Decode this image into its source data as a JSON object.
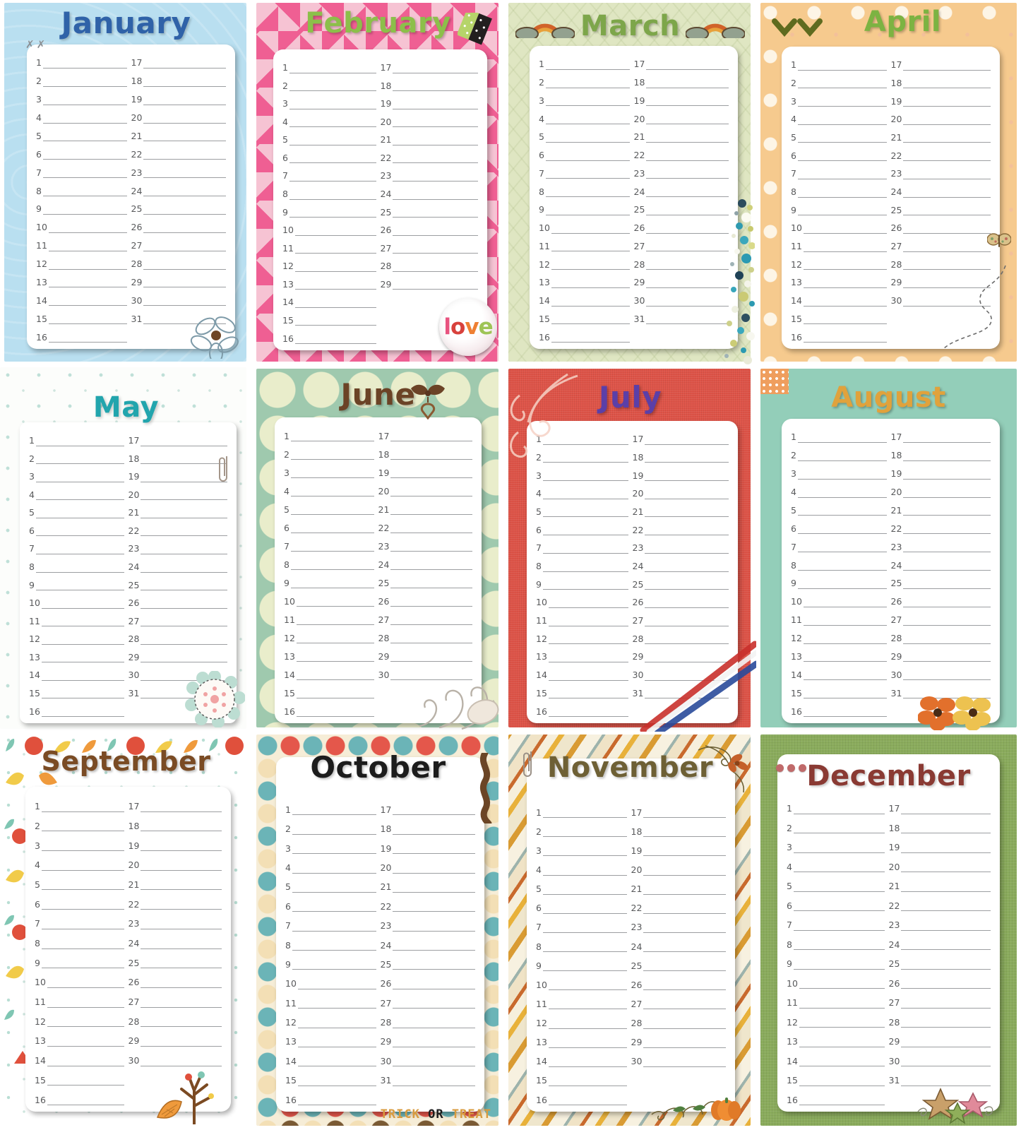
{
  "page": {
    "kind": "printable-monthly-planner-sheet",
    "layout": "3 rows x 4 columns of month cards",
    "left_column_days": [
      1,
      2,
      3,
      4,
      5,
      6,
      7,
      8,
      9,
      10,
      11,
      12,
      13,
      14,
      15,
      16
    ],
    "title_color_note": "each month title uses its own decorative color"
  },
  "months": [
    {
      "id": "january",
      "title": "January",
      "title_color": "#2f62a8",
      "theme_color": "#b9dff0",
      "left_days": [
        "1",
        "2",
        "3",
        "4",
        "5",
        "6",
        "7",
        "8",
        "9",
        "10",
        "11",
        "12",
        "13",
        "14",
        "15",
        "16"
      ],
      "right_days": [
        "17",
        "18",
        "19",
        "20",
        "21",
        "22",
        "23",
        "24",
        "25",
        "26",
        "27",
        "28",
        "29",
        "30",
        "31",
        ""
      ],
      "day_count": 31,
      "decorations": [
        "stitch-marks",
        "wire-flower-brad"
      ]
    },
    {
      "id": "february",
      "title": "February",
      "title_color": "#8cbf4a",
      "theme_color": "#ef5f93",
      "left_days": [
        "1",
        "2",
        "3",
        "4",
        "5",
        "6",
        "7",
        "8",
        "9",
        "10",
        "11",
        "12",
        "13",
        "14",
        "15",
        "16"
      ],
      "right_days": [
        "17",
        "18",
        "19",
        "20",
        "21",
        "22",
        "23",
        "24",
        "25",
        "26",
        "27",
        "28",
        "29",
        "",
        "",
        ""
      ],
      "day_count": 29,
      "decorations": [
        "washi-tape",
        "love-badge"
      ],
      "badge_text": "love",
      "badge_letters": [
        {
          "ch": "l",
          "color": "#e8537f"
        },
        {
          "ch": "o",
          "color": "#d8413c"
        },
        {
          "ch": "v",
          "color": "#ef8033"
        },
        {
          "ch": "e",
          "color": "#9ec456"
        }
      ]
    },
    {
      "id": "march",
      "title": "March",
      "title_color": "#7da64a",
      "theme_color": "#dfe6c2",
      "left_days": [
        "1",
        "2",
        "3",
        "4",
        "5",
        "6",
        "7",
        "8",
        "9",
        "10",
        "11",
        "12",
        "13",
        "14",
        "15",
        "16"
      ],
      "right_days": [
        "17",
        "18",
        "19",
        "20",
        "21",
        "22",
        "23",
        "24",
        "25",
        "26",
        "27",
        "28",
        "29",
        "30",
        "31",
        ""
      ],
      "day_count": 31,
      "decorations": [
        "rainbow-cloud-left",
        "rainbow-cloud-right",
        "bead-cluster"
      ]
    },
    {
      "id": "april",
      "title": "April",
      "title_color": "#7cb342",
      "theme_color": "#f6ca8e",
      "left_days": [
        "1",
        "2",
        "3",
        "4",
        "5",
        "6",
        "7",
        "8",
        "9",
        "10",
        "11",
        "12",
        "13",
        "14",
        "15",
        "16"
      ],
      "right_days": [
        "17",
        "18",
        "19",
        "20",
        "21",
        "22",
        "23",
        "24",
        "25",
        "26",
        "27",
        "28",
        "29",
        "30",
        "",
        ""
      ],
      "day_count": 30,
      "decorations": [
        "leaf-chevrons",
        "butterfly",
        "dashed-flight-path"
      ]
    },
    {
      "id": "may",
      "title": "May",
      "title_color": "#22a5ad",
      "theme_color": "#bfe0d8",
      "left_days": [
        "1",
        "2",
        "3",
        "4",
        "5",
        "6",
        "7",
        "8",
        "9",
        "10",
        "11",
        "12",
        "13",
        "14",
        "15",
        "16"
      ],
      "right_days": [
        "17",
        "18",
        "19",
        "20",
        "21",
        "22",
        "23",
        "24",
        "25",
        "26",
        "27",
        "28",
        "29",
        "30",
        "31",
        ""
      ],
      "day_count": 31,
      "decorations": [
        "paper-clip",
        "doily-flower"
      ]
    },
    {
      "id": "june",
      "title": "June",
      "title_color": "#6b4326",
      "theme_color": "#9fc9ae",
      "left_days": [
        "1",
        "2",
        "3",
        "4",
        "5",
        "6",
        "7",
        "8",
        "9",
        "10",
        "11",
        "12",
        "13",
        "14",
        "15",
        "16"
      ],
      "right_days": [
        "17",
        "18",
        "19",
        "20",
        "21",
        "22",
        "23",
        "24",
        "25",
        "26",
        "27",
        "28",
        "29",
        "30",
        "",
        ""
      ],
      "day_count": 30,
      "decorations": [
        "ribbon-bow-heart-charm",
        "filigree-swirl"
      ]
    },
    {
      "id": "july",
      "title": "July",
      "title_color": "#5b3fa8",
      "theme_color": "#de5347",
      "left_days": [
        "1",
        "2",
        "3",
        "4",
        "5",
        "6",
        "7",
        "8",
        "9",
        "10",
        "11",
        "12",
        "13",
        "14",
        "15",
        "16"
      ],
      "right_days": [
        "17",
        "18",
        "19",
        "20",
        "21",
        "22",
        "23",
        "24",
        "25",
        "26",
        "27",
        "28",
        "29",
        "30",
        "31",
        ""
      ],
      "day_count": 31,
      "decorations": [
        "white-swirl",
        "red-white-blue-stripe"
      ]
    },
    {
      "id": "august",
      "title": "August",
      "title_color": "#e0a23c",
      "theme_color": "#93ceb9",
      "left_days": [
        "1",
        "2",
        "3",
        "4",
        "5",
        "6",
        "7",
        "8",
        "9",
        "10",
        "11",
        "12",
        "13",
        "14",
        "15",
        "16"
      ],
      "right_days": [
        "17",
        "18",
        "19",
        "20",
        "21",
        "22",
        "23",
        "24",
        "25",
        "26",
        "27",
        "28",
        "29",
        "30",
        "31",
        ""
      ],
      "day_count": 31,
      "decorations": [
        "polka-dot-ribbon",
        "orange-flower",
        "yellow-flower"
      ]
    },
    {
      "id": "september",
      "title": "September",
      "title_color": "#7a4b24",
      "theme_color": "#ef9e5e",
      "left_days": [
        "1",
        "2",
        "3",
        "4",
        "5",
        "6",
        "7",
        "8",
        "9",
        "10",
        "11",
        "12",
        "13",
        "14",
        "15",
        "16"
      ],
      "right_days": [
        "17",
        "18",
        "19",
        "20",
        "21",
        "22",
        "23",
        "24",
        "25",
        "26",
        "27",
        "28",
        "29",
        "30",
        "",
        ""
      ],
      "day_count": 30,
      "decorations": [
        "leaf-border",
        "bare-tree",
        "big-leaf"
      ]
    },
    {
      "id": "october",
      "title": "October",
      "title_color": "#1c1c1c",
      "theme_color": "#e4574b",
      "left_days": [
        "1",
        "2",
        "3",
        "4",
        "5",
        "6",
        "7",
        "8",
        "9",
        "10",
        "11",
        "12",
        "13",
        "14",
        "15",
        "16"
      ],
      "right_days": [
        "17",
        "18",
        "19",
        "20",
        "21",
        "22",
        "23",
        "24",
        "25",
        "26",
        "27",
        "28",
        "29",
        "30",
        "31",
        ""
      ],
      "day_count": 31,
      "decorations": [
        "brown-ribbon",
        "trick-or-treat-text"
      ],
      "footer_words": [
        {
          "text": "TRICK",
          "color": "#d89b3e"
        },
        {
          "text": "OR",
          "color": "#1c1c1c"
        },
        {
          "text": "TREAT",
          "color": "#d89b3e"
        }
      ]
    },
    {
      "id": "november",
      "title": "November",
      "title_color": "#6e6035",
      "theme_color": "#e8b13a",
      "left_days": [
        "1",
        "2",
        "3",
        "4",
        "5",
        "6",
        "7",
        "8",
        "9",
        "10",
        "11",
        "12",
        "13",
        "14",
        "15",
        "16"
      ],
      "right_days": [
        "17",
        "18",
        "19",
        "20",
        "21",
        "22",
        "23",
        "24",
        "25",
        "26",
        "27",
        "28",
        "29",
        "30",
        "",
        ""
      ],
      "day_count": 30,
      "decorations": [
        "paper-clip",
        "autumn-corner-flourish",
        "pumpkin-vine"
      ]
    },
    {
      "id": "december",
      "title": "December",
      "title_color": "#8a3a33",
      "theme_color": "#8aab5c",
      "left_days": [
        "1",
        "2",
        "3",
        "4",
        "5",
        "6",
        "7",
        "8",
        "9",
        "10",
        "11",
        "12",
        "13",
        "14",
        "15",
        "16"
      ],
      "right_days": [
        "17",
        "18",
        "19",
        "20",
        "21",
        "22",
        "23",
        "24",
        "25",
        "26",
        "27",
        "28",
        "29",
        "30",
        "31",
        ""
      ],
      "day_count": 31,
      "decorations": [
        "three-red-dots",
        "star-trio"
      ]
    }
  ]
}
